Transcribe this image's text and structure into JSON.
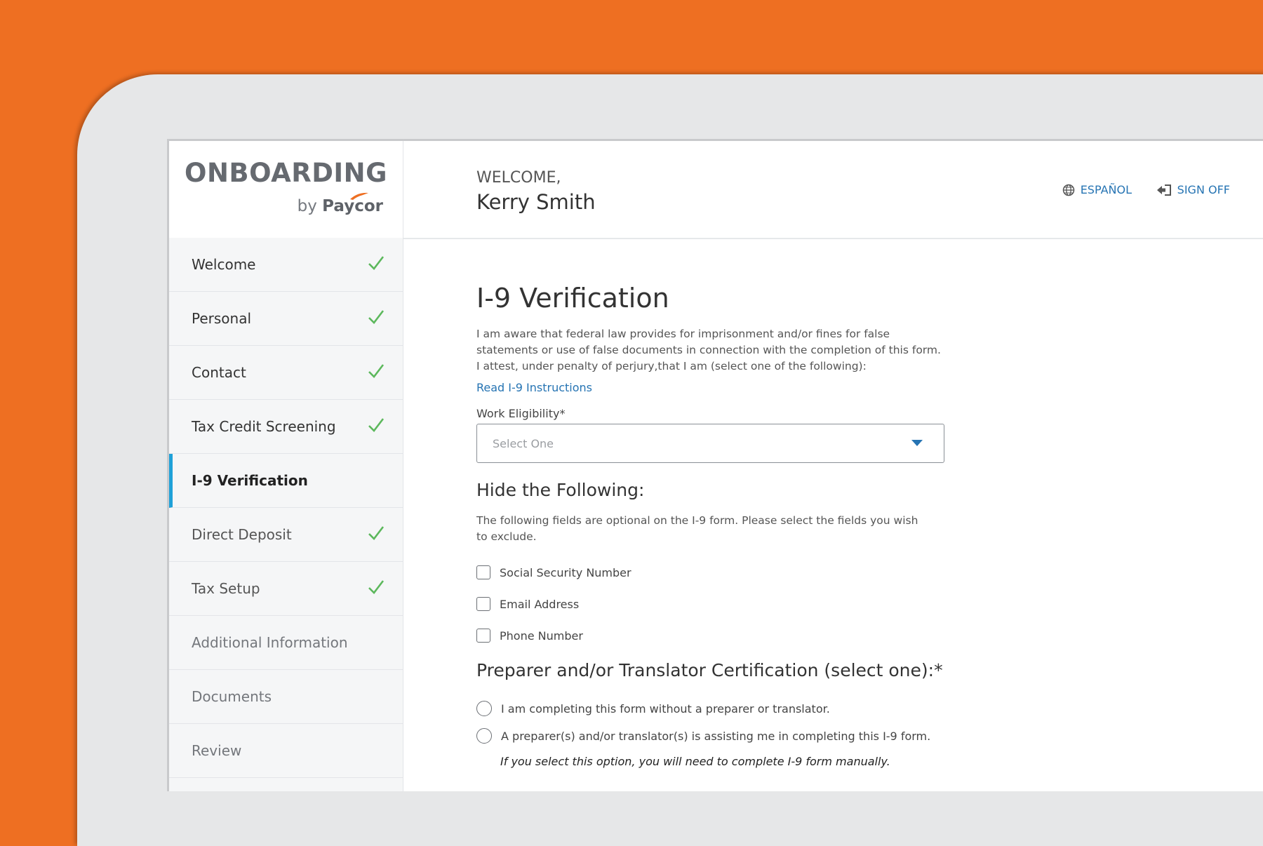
{
  "brand": {
    "title": "ONBOARDING",
    "by": "by",
    "company": "Paycor"
  },
  "header": {
    "welcome_label": "WELCOME,",
    "user_name": "Kerry Smith",
    "language_link": "ESPAÑOL",
    "sign_off": "SIGN OFF"
  },
  "sidebar": {
    "items": [
      {
        "label": "Welcome",
        "state": "complete"
      },
      {
        "label": "Personal",
        "state": "complete"
      },
      {
        "label": "Contact",
        "state": "complete"
      },
      {
        "label": "Tax Credit Screening",
        "state": "complete"
      },
      {
        "label": "I-9 Verification",
        "state": "active"
      },
      {
        "label": "Direct Deposit",
        "state": "complete"
      },
      {
        "label": "Tax Setup",
        "state": "complete"
      },
      {
        "label": "Additional Information",
        "state": "todo"
      },
      {
        "label": "Documents",
        "state": "todo"
      },
      {
        "label": "Review",
        "state": "todo"
      }
    ]
  },
  "main": {
    "title": "I-9 Verification",
    "intro": "I am aware that federal law provides for imprisonment and/or fines for false statements or use of false documents in connection with the completion of this form. I attest, under penalty of perjury,that I am (select one of the following):",
    "instructions_link": "Read I-9 Instructions",
    "work_eligibility": {
      "label": "Work Eligibility*",
      "placeholder": "Select One"
    },
    "hide_section": {
      "title": "Hide the Following:",
      "help": "The following fields are optional on the I-9 form. Please select the fields you wish to exclude.",
      "options": [
        "Social Security Number",
        "Email Address",
        "Phone Number"
      ]
    },
    "preparer_section": {
      "title": "Preparer and/or Translator Certification (select one):*",
      "options": [
        "I am completing this form without a preparer or translator.",
        "A preparer(s) and/or translator(s) is assisting me in completing this I-9 form."
      ],
      "note": "If you select this option, you will need to complete I-9 form manually."
    }
  },
  "colors": {
    "background": "#ee6f22",
    "link": "#2674b3",
    "check": "#5cb85c",
    "active_indicator": "#1fa1d8"
  }
}
